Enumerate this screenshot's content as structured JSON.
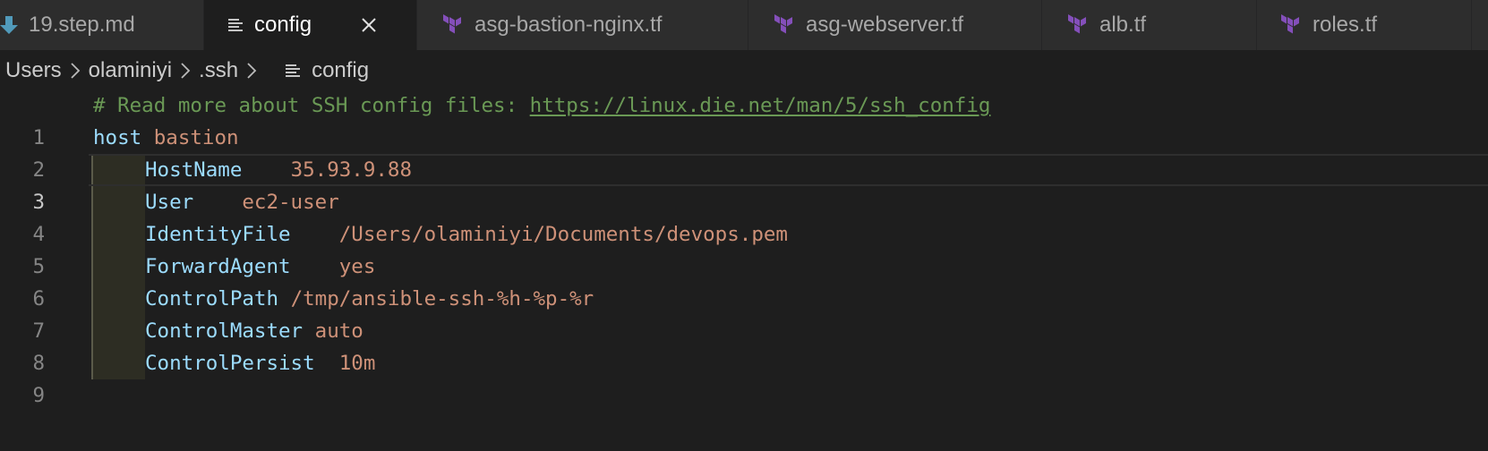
{
  "tabs": [
    {
      "label": "19.step.md",
      "icon": "download-arrow-icon",
      "active": false
    },
    {
      "label": "config",
      "icon": "lines-file-icon",
      "active": true
    },
    {
      "label": "asg-bastion-nginx.tf",
      "icon": "terraform-icon",
      "active": false
    },
    {
      "label": "asg-webserver.tf",
      "icon": "terraform-icon",
      "active": false
    },
    {
      "label": "alb.tf",
      "icon": "terraform-icon",
      "active": false
    },
    {
      "label": "roles.tf",
      "icon": "terraform-icon",
      "active": false
    }
  ],
  "breadcrumb": {
    "segments": [
      "Users",
      "olaminiyi",
      ".ssh",
      "config"
    ],
    "file_icon": "lines-file-icon"
  },
  "editor": {
    "current_line": 3,
    "lines": [
      {
        "num": "1",
        "comment": "# Read more about SSH config files: ",
        "link": "https://linux.die.net/man/5/ssh_config"
      },
      {
        "num": "2",
        "key": "host",
        "sep": " ",
        "value": "bastion"
      },
      {
        "num": "3",
        "key": "HostName",
        "sep": "    ",
        "value": "35.93.9.88"
      },
      {
        "num": "4",
        "key": "User",
        "sep": "    ",
        "value": "ec2-user"
      },
      {
        "num": "5",
        "key": "IdentityFile",
        "sep": "    ",
        "value": "/Users/olaminiyi/Documents/devops.pem"
      },
      {
        "num": "6",
        "key": "ForwardAgent",
        "sep": "    ",
        "value": "yes"
      },
      {
        "num": "7",
        "key": "ControlPath",
        "sep": " ",
        "value": "/tmp/ansible-ssh-%h-%p-%r"
      },
      {
        "num": "8",
        "key": "ControlMaster",
        "sep": " ",
        "value": "auto"
      },
      {
        "num": "9",
        "key": "ControlPersist",
        "sep": "  ",
        "value": "10m"
      }
    ]
  },
  "colors": {
    "background": "#1e1e1e",
    "tab_inactive": "#2d2d2d",
    "terraform": "#844fba",
    "download_icon": "#519aba",
    "comment": "#6a9955",
    "keyword": "#9cdcfe",
    "string": "#ce9178",
    "line_number": "#858585"
  }
}
